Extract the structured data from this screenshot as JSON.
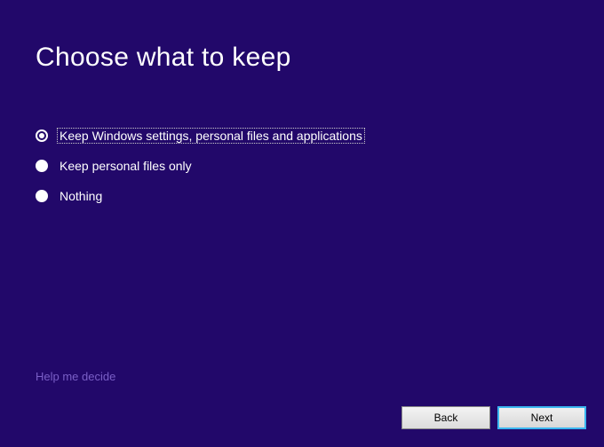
{
  "title": "Choose what to keep",
  "options": [
    {
      "label": "Keep Windows settings, personal files and applications",
      "selected": true
    },
    {
      "label": "Keep personal files only",
      "selected": false
    },
    {
      "label": "Nothing",
      "selected": false
    }
  ],
  "help_link": "Help me decide",
  "buttons": {
    "back": "Back",
    "next": "Next"
  }
}
